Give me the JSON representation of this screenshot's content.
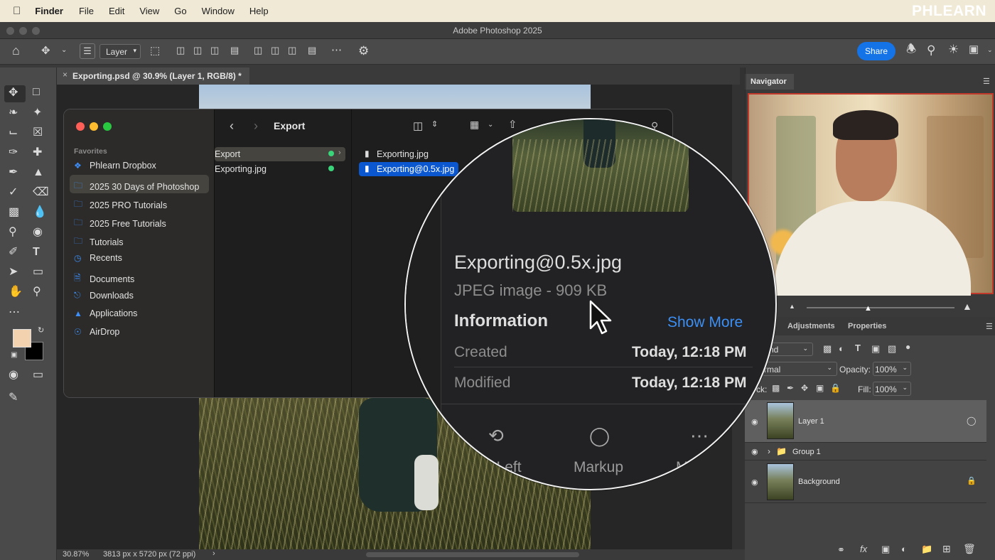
{
  "menubar": {
    "apple": "",
    "app": "Finder",
    "items": [
      "File",
      "Edit",
      "View",
      "Go",
      "Window",
      "Help"
    ],
    "brand": "PHLEARN"
  },
  "photoshop": {
    "window_title": "Adobe Photoshop 2025",
    "options": {
      "layer_select": "Layer",
      "share_label": "Share"
    },
    "doc_tab": "Exporting.psd @ 30.9% (Layer 1, RGB/8) *",
    "doc_tab_close": "×",
    "status": {
      "zoom": "30.87%",
      "dimensions": "3813 px x 5720 px (72 ppi)"
    },
    "navigator": {
      "tab": "Navigator"
    },
    "layers_panel": {
      "tabs": [
        "Adjustments",
        "Properties"
      ],
      "kind_label": "nd",
      "blend_mode": "rmal",
      "opacity_label": "Opacity:",
      "opacity_value": "100%",
      "lock_label": "ck:",
      "fill_label": "Fill:",
      "fill_value": "100%",
      "layers": [
        {
          "name": "Layer 1"
        },
        {
          "name": "Group 1"
        },
        {
          "name": "Background"
        }
      ]
    }
  },
  "finder": {
    "title": "Export",
    "favorites_label": "Favorites",
    "sidebar": [
      {
        "label": "Phlearn Dropbox",
        "icon": "dropbox-icon"
      },
      {
        "label": "2025 30 Days of Photoshop",
        "icon": "folder-icon"
      },
      {
        "label": "2025 PRO Tutorials",
        "icon": "folder-icon"
      },
      {
        "label": "2025 Free Tutorials",
        "icon": "folder-icon"
      },
      {
        "label": "Tutorials",
        "icon": "folder-icon"
      },
      {
        "label": "Recents",
        "icon": "clock-icon"
      },
      {
        "label": "Documents",
        "icon": "document-icon"
      },
      {
        "label": "Downloads",
        "icon": "download-icon"
      },
      {
        "label": "Applications",
        "icon": "applications-icon"
      },
      {
        "label": "AirDrop",
        "icon": "airdrop-icon"
      }
    ],
    "column1": [
      "Export",
      "Exporting.jpg"
    ],
    "column2": [
      "Exporting.jpg",
      "Exporting@0.5x.jpg"
    ]
  },
  "preview": {
    "filename": "Exporting@0.5x.jpg",
    "kind_size": "JPEG image - 909 KB",
    "info_heading": "Information",
    "show_more": "Show More",
    "created_label": "Created",
    "created_value": "Today, 12:18 PM",
    "modified_label": "Modified",
    "modified_value": "Today, 12:18 PM",
    "actions": [
      "e Left",
      "Markup",
      "M"
    ]
  },
  "colors": {
    "accent": "#1473e6",
    "finder_selection": "#0b57d0",
    "fg_swatch": "#f3d2b0",
    "bg_swatch": "#000000"
  }
}
